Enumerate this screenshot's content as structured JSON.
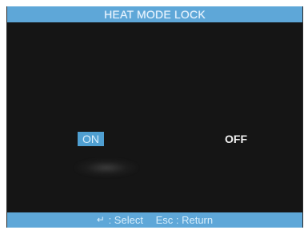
{
  "screen": {
    "title": "HEAT MODE LOCK",
    "options": {
      "on_label": "ON",
      "off_label": "OFF",
      "selected": "ON"
    },
    "footer": {
      "select_key_icon": "↵",
      "select_text": ": Select",
      "return_key": "Esc",
      "return_text": ": Return"
    }
  },
  "colors": {
    "accent": "#5EA7D8",
    "background": "#151515",
    "selected_bg": "#4F9FD1",
    "text": "#F1F1F1"
  },
  "icons": {
    "enter_key": "enter-icon"
  }
}
